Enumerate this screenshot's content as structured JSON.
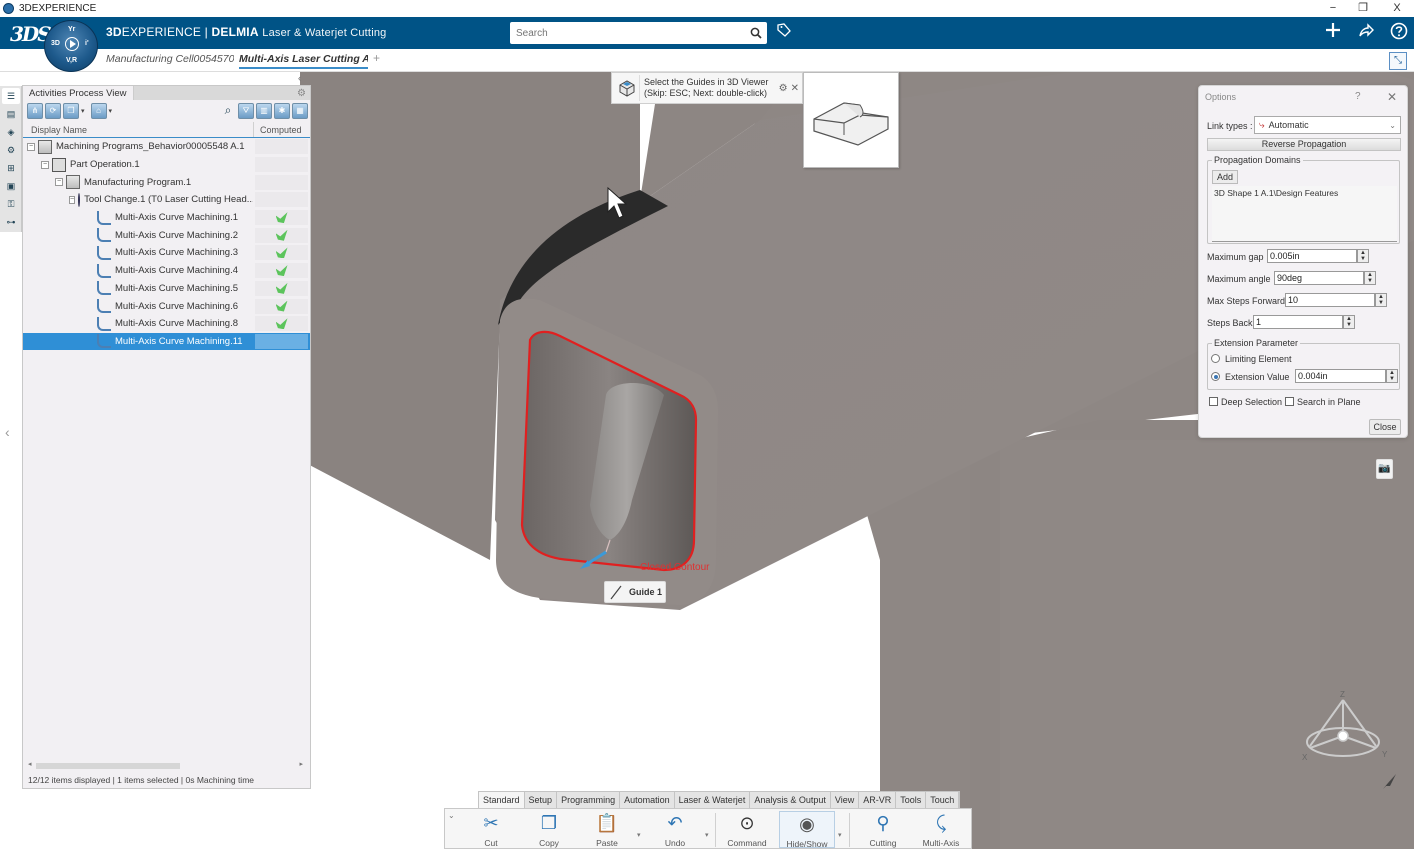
{
  "window": {
    "title": "3DEXPERIENCE",
    "controls": {
      "minimize": "−",
      "restore": "❐",
      "close": "X"
    }
  },
  "topbar": {
    "brand_logo": "3DS",
    "compass_labels": {
      "top": "Yr",
      "left": "3D",
      "right": "i'",
      "bottom": "V,R"
    },
    "title_bold_prefix": "3D",
    "title_prefix_rest": "EXPERIENCE",
    "title_separator": " | ",
    "title_brand": "DELMIA",
    "title_app": "Laser & Waterjet Cutting",
    "search_placeholder": "Search",
    "icons": [
      "tag-icon",
      "plus-icon",
      "share-icon",
      "help-icon"
    ]
  },
  "doc_tabs": [
    {
      "label": "Manufacturing Cell0054570",
      "active": false
    },
    {
      "label": "Multi-Axis Laser Cutting A.",
      "active": true
    }
  ],
  "doc_tab_add": "+",
  "side_toolbar": {
    "icons": [
      "tree-icon",
      "list-icon",
      "activity-icon",
      "resource-icon",
      "group-icon",
      "machine-icon",
      "robot-icon",
      "layout-icon"
    ]
  },
  "panel": {
    "tab_label": "Activities Process View",
    "columns": [
      "Display Name",
      "Computed"
    ],
    "tree": [
      {
        "label": "Machining Programs_Behavior00005548 A.1",
        "level": 0,
        "icon": "program-icon",
        "expander": "−",
        "computed": ""
      },
      {
        "label": "Part Operation.1",
        "level": 1,
        "icon": "part-operation-icon",
        "expander": "−",
        "computed": ""
      },
      {
        "label": "Manufacturing Program.1",
        "level": 2,
        "icon": "manufacturing-program-icon",
        "expander": "−",
        "computed": ""
      },
      {
        "label": "Tool Change.1 (T0 Laser Cutting Head...",
        "level": 3,
        "icon": "tool-change-icon",
        "expander": "−",
        "computed": ""
      },
      {
        "label": "Multi-Axis Curve Machining.1",
        "level": 4,
        "icon": "curve-machining-icon",
        "computed": "computed-warning"
      },
      {
        "label": "Multi-Axis Curve Machining.2",
        "level": 4,
        "icon": "curve-machining-icon",
        "computed": "computed-warning"
      },
      {
        "label": "Multi-Axis Curve Machining.3",
        "level": 4,
        "icon": "curve-machining-icon",
        "computed": "computed-error"
      },
      {
        "label": "Multi-Axis Curve Machining.4",
        "level": 4,
        "icon": "curve-machining-icon",
        "computed": "computed-ok"
      },
      {
        "label": "Multi-Axis Curve Machining.5",
        "level": 4,
        "icon": "curve-machining-icon",
        "computed": "computed-ok"
      },
      {
        "label": "Multi-Axis Curve Machining.6",
        "level": 4,
        "icon": "curve-machining-icon",
        "computed": "computed-ok"
      },
      {
        "label": "Multi-Axis Curve Machining.8",
        "level": 4,
        "icon": "curve-machining-icon",
        "computed": "computed-ok"
      },
      {
        "label": "Multi-Axis Curve Machining.11",
        "level": 4,
        "icon": "curve-machining-icon",
        "computed": "",
        "selected": true
      }
    ],
    "status": "12/12 items displayed | 1 items selected | 0s Machining time"
  },
  "prompt": {
    "line1": "Select the Guides in 3D Viewer",
    "line2": "(Skip: ESC; Next: double-click)"
  },
  "options_dialog": {
    "title": "Options",
    "help": "?",
    "close_x": "✕",
    "link_types_label": "Link types :",
    "link_types_value": "Automatic",
    "reverse_button": "Reverse Propagation",
    "propagation_domains_title": "Propagation Domains",
    "add_button": "Add",
    "domains": [
      "3D Shape 1 A.1\\Design Features"
    ],
    "max_gap_label": "Maximum gap",
    "max_gap_value": "0.005in",
    "max_angle_label": "Maximum angle",
    "max_angle_value": "90deg",
    "max_steps_forward_label": "Max Steps Forward",
    "max_steps_forward_value": "10",
    "steps_back_label": "Steps Back",
    "steps_back_value": "1",
    "extension_title": "Extension Parameter",
    "limiting_element_label": "Limiting Element",
    "limiting_element_checked": false,
    "extension_value_label": "Extension Value",
    "extension_value_checked": true,
    "extension_value": "0.004in",
    "deep_selection_label": "Deep Selection",
    "deep_selection_checked": false,
    "search_in_plane_label": "Search in Plane",
    "search_in_plane_checked": false,
    "close_button": "Close"
  },
  "viewport": {
    "contour_label": "Closed Contour",
    "guide_label": "Guide 1",
    "axis_labels": {
      "x": "X",
      "y": "Y",
      "z": "Z"
    },
    "colors": {
      "tube": "#8b8582",
      "contour": "#e02020",
      "guide": "#3c9ad8"
    }
  },
  "action_bar": {
    "tabs": [
      {
        "label": "Standard",
        "active": true
      },
      {
        "label": "Setup"
      },
      {
        "label": "Programming"
      },
      {
        "label": "Automation"
      },
      {
        "label": "Laser & Waterjet"
      },
      {
        "label": "Analysis & Output"
      },
      {
        "label": "View"
      },
      {
        "label": "AR-VR"
      },
      {
        "label": "Tools"
      },
      {
        "label": "Touch"
      }
    ],
    "commands": [
      {
        "label": "Cut",
        "icon": "scissors-icon"
      },
      {
        "label": "Copy",
        "icon": "copy-icon"
      },
      {
        "label": "Paste",
        "icon": "paste-icon"
      },
      {
        "label": "Undo",
        "icon": "undo-icon"
      },
      {
        "label": "Command",
        "icon": "command-search-icon"
      },
      {
        "label": "Hide/Show",
        "icon": "hide-show-icon"
      },
      {
        "label": "Cutting",
        "icon": "cutting-icon"
      },
      {
        "label": "Multi-Axis",
        "icon": "multi-axis-icon"
      }
    ]
  },
  "colors": {
    "topbar": "#005386",
    "selection": "#2f8fd6",
    "accent": "#3a8cc8"
  }
}
